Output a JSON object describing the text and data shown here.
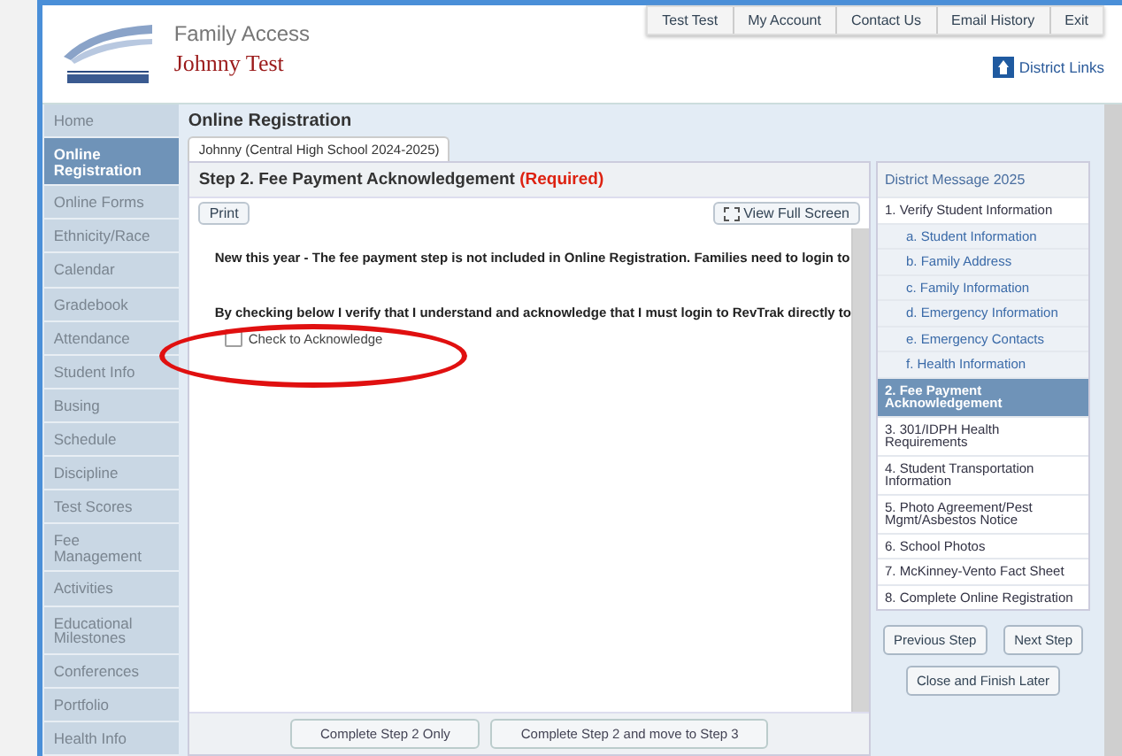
{
  "header": {
    "app_title": "Family Access",
    "user_name": "Johnny Test",
    "links": [
      "Test Test",
      "My Account",
      "Contact Us",
      "Email History",
      "Exit"
    ],
    "district_links": "District Links"
  },
  "sidebar": {
    "items": [
      {
        "label": "Home",
        "selected": false
      },
      {
        "label": "Online Registration",
        "selected": true
      },
      {
        "label": "Online Forms",
        "selected": false
      },
      {
        "label": "Ethnicity/Race",
        "selected": false
      },
      {
        "label": "Calendar",
        "selected": false
      },
      {
        "label": "Gradebook",
        "selected": false
      },
      {
        "label": "Attendance",
        "selected": false
      },
      {
        "label": "Student Info",
        "selected": false
      },
      {
        "label": "Busing",
        "selected": false
      },
      {
        "label": "Schedule",
        "selected": false
      },
      {
        "label": "Discipline",
        "selected": false
      },
      {
        "label": "Test Scores",
        "selected": false
      },
      {
        "label": "Fee Management",
        "selected": false
      },
      {
        "label": "Activities",
        "selected": false
      },
      {
        "label": "Educational Milestones",
        "selected": false
      },
      {
        "label": "Conferences",
        "selected": false
      },
      {
        "label": "Portfolio",
        "selected": false
      },
      {
        "label": "Health Info",
        "selected": false
      }
    ]
  },
  "page_title": "Online Registration",
  "student_tab": "Johnny (Central High School 2024-2025)",
  "step": {
    "title": "Step 2. Fee Payment Acknowledgement",
    "required": "(Required)",
    "print": "Print",
    "full_screen": "View Full Screen",
    "paragraphs": [
      "New this year - The fee payment step is not included in Online Registration. Families need to login to",
      "By checking below I verify that I understand and acknowledge that I must login to RevTrak directly to"
    ],
    "checkbox": {
      "label": "Check to Acknowledge",
      "checked": false
    }
  },
  "steps_panel": {
    "title": "District Message 2025",
    "items": [
      {
        "label": "1. Verify Student Information",
        "kind": "step",
        "selected": false
      },
      {
        "label": "a. Student Information",
        "kind": "sub",
        "selected": false
      },
      {
        "label": "b. Family Address",
        "kind": "sub",
        "selected": false
      },
      {
        "label": "c. Family Information",
        "kind": "sub",
        "selected": false
      },
      {
        "label": "d. Emergency Information",
        "kind": "sub",
        "selected": false
      },
      {
        "label": "e. Emergency Contacts",
        "kind": "sub",
        "selected": false
      },
      {
        "label": "f. Health Information",
        "kind": "sub",
        "selected": false
      },
      {
        "label": "2. Fee Payment Acknowledgement",
        "kind": "step",
        "selected": true
      },
      {
        "label": "3. 301/IDPH Health Requirements",
        "kind": "step",
        "selected": false
      },
      {
        "label": "4. Student Transportation Information",
        "kind": "step",
        "selected": false
      },
      {
        "label": "5. Photo Agreement/Pest Mgmt/Asbestos Notice",
        "kind": "step",
        "selected": false
      },
      {
        "label": "6. School Photos",
        "kind": "step",
        "selected": false
      },
      {
        "label": "7. McKinney-Vento Fact Sheet",
        "kind": "step",
        "selected": false
      },
      {
        "label": "8. Complete Online Registration",
        "kind": "step",
        "selected": false
      }
    ],
    "previous": "Previous Step",
    "next": "Next Step",
    "close": "Close and Finish Later"
  },
  "footer_buttons": [
    "Complete Step 2 Only",
    "Complete Step 2 and move to Step 3"
  ]
}
